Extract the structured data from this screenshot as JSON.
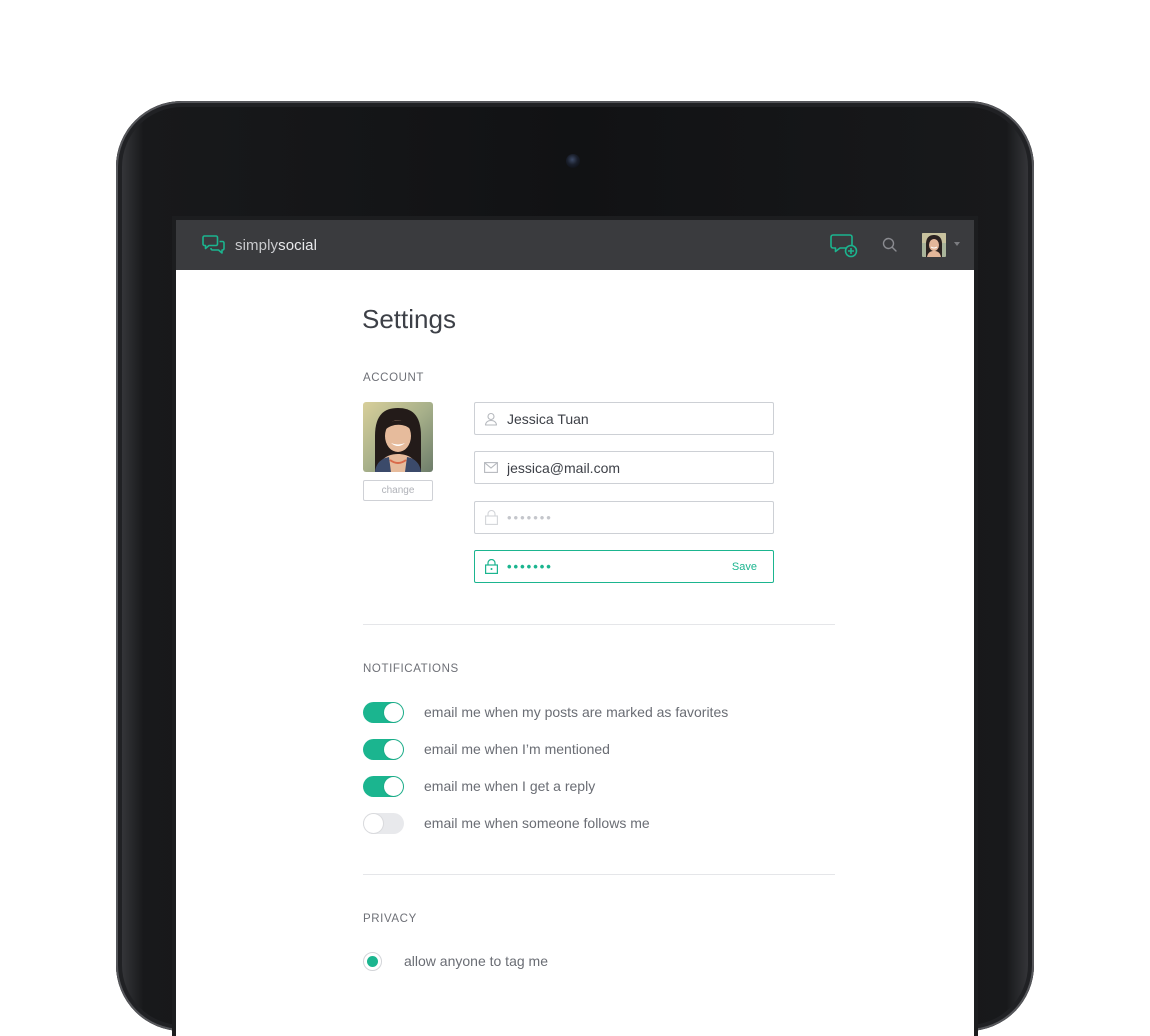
{
  "colors": {
    "accent": "#1bb58f",
    "topbar": "#3a3b3e",
    "text": "#3d4047",
    "muted": "#6a6d74"
  },
  "app": {
    "logo_light": "simply",
    "logo_bold": "social"
  },
  "nav": {
    "compose_icon": "chat-plus-icon",
    "search_icon": "search-icon",
    "profile_icon": "avatar",
    "menu_icon": "caret-down-icon"
  },
  "page": {
    "title": "Settings"
  },
  "account": {
    "label": "ACCOUNT",
    "change_label": "change",
    "name_value": "Jessica Tuan",
    "email_value": "jessica@mail.com",
    "password_value": "•••••••",
    "new_password_value": "•••••••",
    "save_label": "Save"
  },
  "notifications": {
    "label": "NOTIFICATIONS",
    "items": [
      {
        "label": "email me when my posts are marked as favorites",
        "on": true
      },
      {
        "label": "email me when I’m mentioned",
        "on": true
      },
      {
        "label": "email me when I get a reply",
        "on": true
      },
      {
        "label": "email me when someone follows me",
        "on": false
      }
    ]
  },
  "privacy": {
    "label": "PRIVACY",
    "options": [
      {
        "label": "allow anyone to tag me",
        "selected": true
      }
    ]
  }
}
